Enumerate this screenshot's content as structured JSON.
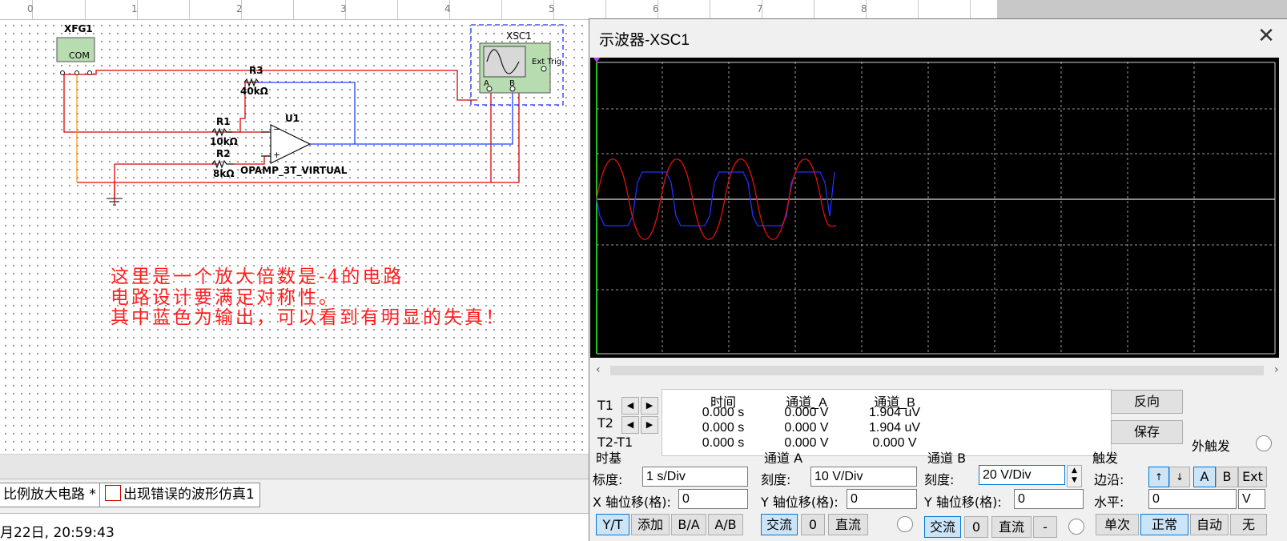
{
  "ruler": {
    "ticks": [
      "0",
      "1",
      "2",
      "3",
      "4",
      "5",
      "6",
      "7",
      "8"
    ]
  },
  "schematic": {
    "xfg1_label": "XFG1",
    "xfg1_text": "COM",
    "xsc1_label": "XSC1",
    "ext_trig": "Ext Trig",
    "ch_a": "A",
    "ch_b": "B",
    "r3_name": "R3",
    "r3_value": "40kΩ",
    "r1_name": "R1",
    "r1_value": "10kΩ",
    "r2_name": "R2",
    "r2_value": "8kΩ",
    "u1_name": "U1",
    "u1_model": "OPAMP_3T_VIRTUAL",
    "opamp_minus": "−",
    "opamp_plus": "+"
  },
  "note": {
    "line1": "这里是一个放大倍数是-4的电路",
    "line2": "电路设计要满足对称性。",
    "line3": "其中蓝色为输出，可以看到有明显的失真！"
  },
  "tabs": [
    {
      "label": "比例放大电路 *"
    },
    {
      "label": "出现错误的波形仿真1"
    }
  ],
  "status": {
    "text": "月22日, 20:59:43"
  },
  "scope": {
    "title": "示波器-XSC1",
    "readout": {
      "headers": [
        "时间",
        "通道_A",
        "通道_B"
      ],
      "rows": [
        {
          "label": "T1",
          "time": "0.000 s",
          "a": "0.000 V",
          "b": "1.904 uV"
        },
        {
          "label": "T2",
          "time": "0.000 s",
          "a": "0.000 V",
          "b": "1.904 uV"
        },
        {
          "label": "T2-T1",
          "time": "0.000 s",
          "a": "0.000 V",
          "b": "0.000 V"
        }
      ]
    },
    "reverse_label": "反向",
    "save_label": "保存",
    "ext_trigger_label": "外触发",
    "timebase": {
      "title": "时基",
      "scale_label": "标度:",
      "scale": "1  s/Div",
      "xpos_label": "X 轴位移(格):",
      "xpos": "0",
      "buttons": [
        "Y/T",
        "添加",
        "B/A",
        "A/B"
      ]
    },
    "channel_a": {
      "title": "通道 A",
      "scale_label": "刻度:",
      "scale": "10  V/Div",
      "ypos_label": "Y 轴位移(格):",
      "ypos": "0",
      "buttons": [
        "交流",
        "0",
        "直流"
      ]
    },
    "channel_b": {
      "title": "通道 B",
      "scale_label": "刻度:",
      "scale": "20  V/Div",
      "ypos_label": "Y 轴位移(格):",
      "ypos": "0",
      "buttons": [
        "交流",
        "0",
        "直流",
        "-"
      ]
    },
    "trigger": {
      "title": "触发",
      "edge_label": "边沿:",
      "level_label": "水平:",
      "level": "0",
      "level_unit": "V",
      "edge_buttons": [
        "↑",
        "↓",
        "A",
        "B",
        "Ext"
      ],
      "mode_buttons": [
        "单次",
        "正常",
        "自动",
        "无"
      ]
    }
  },
  "colors": {
    "wire_red": "#e00000",
    "wire_blue": "#1f3fff",
    "wire_orange": "#ff9a1a",
    "trace_a": "#e01010",
    "trace_b": "#2030ff",
    "note": "#ff1e1e"
  }
}
